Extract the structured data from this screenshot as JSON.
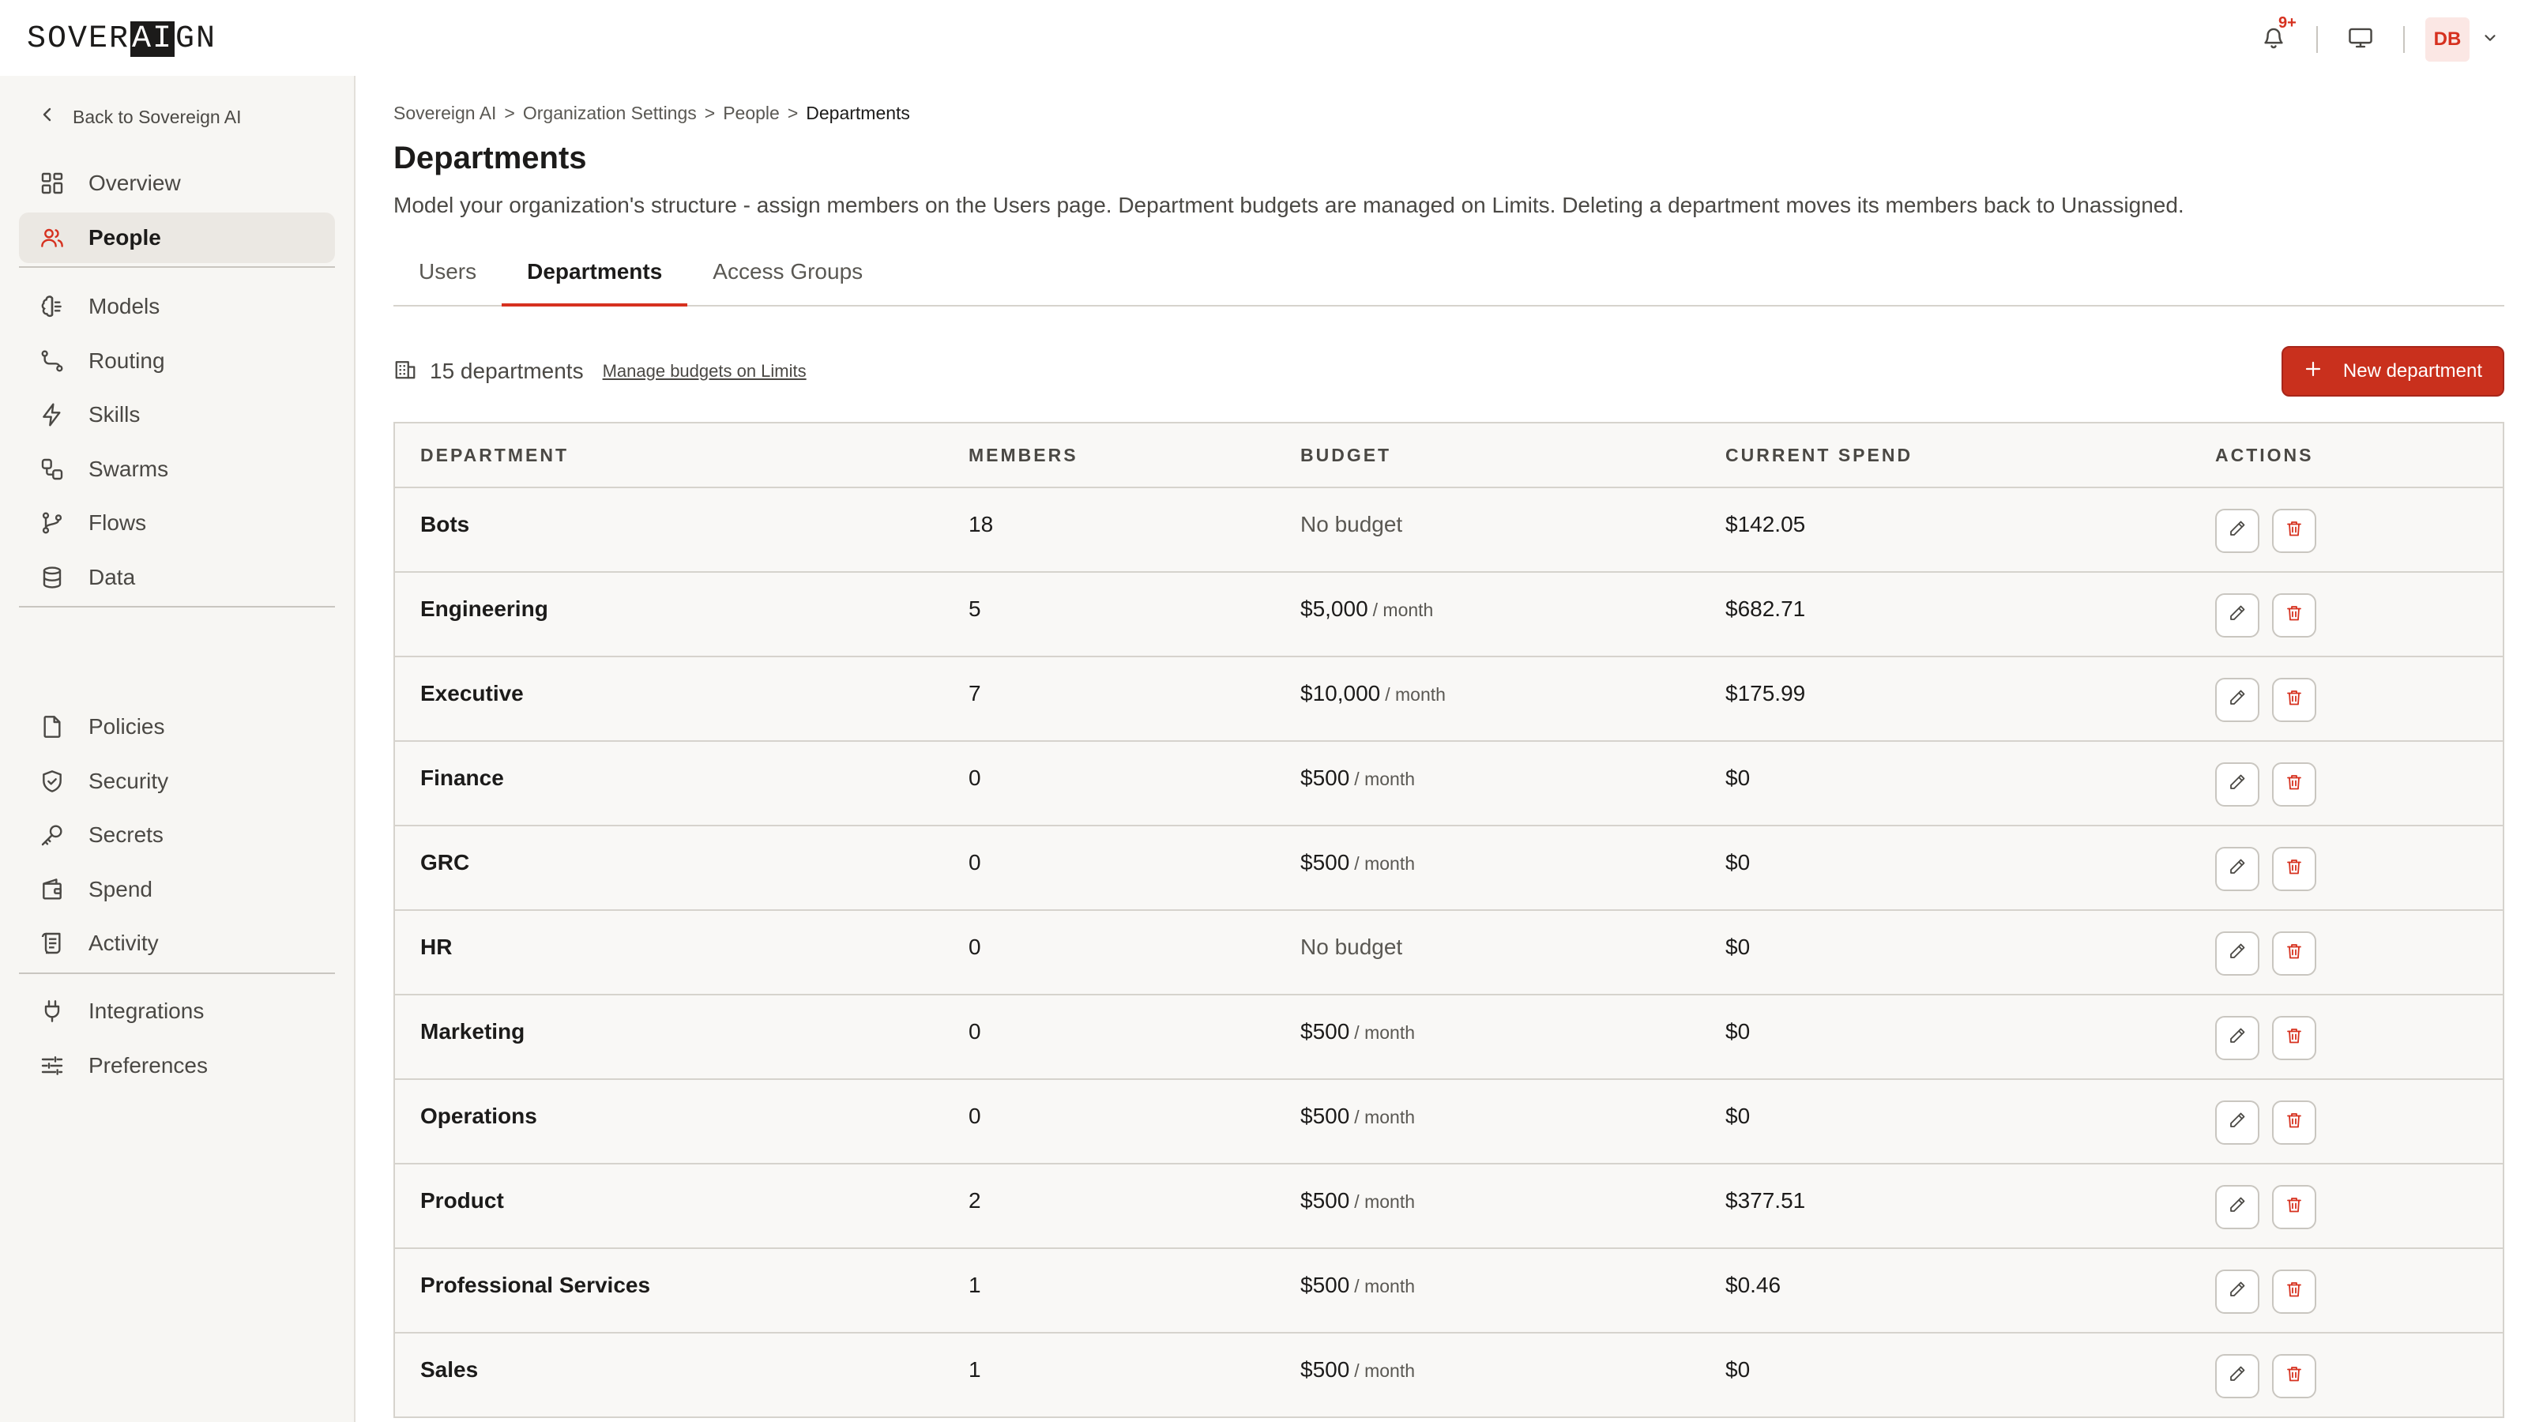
{
  "brand": {
    "pre": "SOVER",
    "mid": "AI",
    "post": "GN"
  },
  "topbar": {
    "notif_count": "9+",
    "avatar_initials": "DB"
  },
  "sidebar": {
    "back_label": "Back to Sovereign AI",
    "groups": [
      [
        {
          "label": "Overview",
          "icon": "grid-icon"
        },
        {
          "label": "People",
          "icon": "users-icon",
          "active": true
        }
      ],
      [
        {
          "label": "Models",
          "icon": "brain-icon"
        },
        {
          "label": "Routing",
          "icon": "route-icon"
        },
        {
          "label": "Skills",
          "icon": "lightning-icon"
        },
        {
          "label": "Swarms",
          "icon": "swarm-icon"
        },
        {
          "label": "Flows",
          "icon": "branch-icon"
        },
        {
          "label": "Data",
          "icon": "database-icon"
        }
      ],
      [
        {
          "label": "Policies",
          "icon": "document-icon"
        },
        {
          "label": "Security",
          "icon": "shield-icon"
        },
        {
          "label": "Secrets",
          "icon": "key-icon"
        },
        {
          "label": "Spend",
          "icon": "wallet-icon"
        },
        {
          "label": "Activity",
          "icon": "scroll-icon"
        }
      ],
      [
        {
          "label": "Integrations",
          "icon": "plug-icon"
        },
        {
          "label": "Preferences",
          "icon": "sliders-icon"
        }
      ]
    ]
  },
  "breadcrumb": {
    "items": [
      "Sovereign AI",
      "Organization Settings",
      "People"
    ],
    "current": "Departments",
    "separator": ">"
  },
  "page": {
    "title": "Departments",
    "description": "Model your organization's structure - assign members on the Users page. Department budgets are managed on Limits. Deleting a department moves its members back to Unassigned."
  },
  "tabs": [
    {
      "label": "Users"
    },
    {
      "label": "Departments",
      "active": true
    },
    {
      "label": "Access Groups"
    }
  ],
  "toolbar": {
    "count_label": "15 departments",
    "manage_link": "Manage budgets on Limits",
    "new_button": "New department"
  },
  "table": {
    "headers": [
      "DEPARTMENT",
      "MEMBERS",
      "BUDGET",
      "CURRENT SPEND",
      "ACTIONS"
    ],
    "rows": [
      {
        "name": "Bots",
        "members": "18",
        "budget": "No budget",
        "period": "",
        "spend": "$142.05"
      },
      {
        "name": "Engineering",
        "members": "5",
        "budget": "$5,000",
        "period": "/ month",
        "spend": "$682.71"
      },
      {
        "name": "Executive",
        "members": "7",
        "budget": "$10,000",
        "period": "/ month",
        "spend": "$175.99"
      },
      {
        "name": "Finance",
        "members": "0",
        "budget": "$500",
        "period": "/ month",
        "spend": "$0"
      },
      {
        "name": "GRC",
        "members": "0",
        "budget": "$500",
        "period": "/ month",
        "spend": "$0"
      },
      {
        "name": "HR",
        "members": "0",
        "budget": "No budget",
        "period": "",
        "spend": "$0"
      },
      {
        "name": "Marketing",
        "members": "0",
        "budget": "$500",
        "period": "/ month",
        "spend": "$0"
      },
      {
        "name": "Operations",
        "members": "0",
        "budget": "$500",
        "period": "/ month",
        "spend": "$0"
      },
      {
        "name": "Product",
        "members": "2",
        "budget": "$500",
        "period": "/ month",
        "spend": "$377.51"
      },
      {
        "name": "Professional Services",
        "members": "1",
        "budget": "$500",
        "period": "/ month",
        "spend": "$0.46"
      },
      {
        "name": "Sales",
        "members": "1",
        "budget": "$500",
        "period": "/ month",
        "spend": "$0"
      }
    ]
  },
  "colors": {
    "accent": "#d6311f",
    "button": "#c9301d",
    "sidebar_bg": "#f7f6f3",
    "active_nav_bg": "#ebe8e3"
  }
}
